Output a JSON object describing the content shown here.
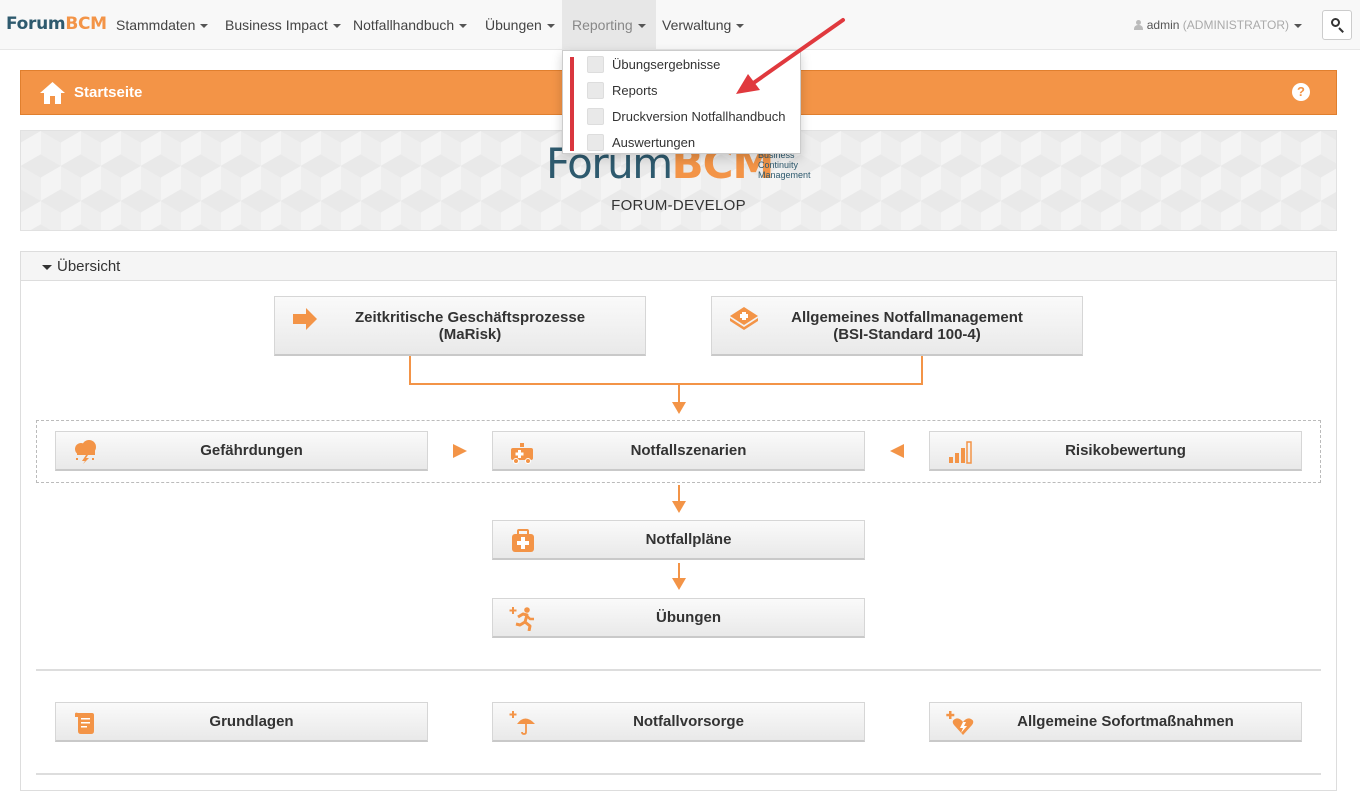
{
  "navbar": {
    "brand_forum": "Forum",
    "brand_bcm": "BCM",
    "items": [
      {
        "label": "Stammdaten"
      },
      {
        "label": "Business Impact"
      },
      {
        "label": "Notfallhandbuch"
      },
      {
        "label": "Übungen"
      },
      {
        "label": "Reporting"
      },
      {
        "label": "Verwaltung"
      }
    ],
    "user_name": "admin",
    "user_role": "(ADMINISTRATOR)"
  },
  "reporting_menu": {
    "items": [
      {
        "label": "Übungsergebnisse",
        "icon": "results-icon"
      },
      {
        "label": "Reports",
        "icon": "reports-icon"
      },
      {
        "label": "Druckversion Notfallhandbuch",
        "icon": "print-icon"
      },
      {
        "label": "Auswertungen",
        "icon": "evaluation-icon"
      }
    ]
  },
  "page": {
    "title": "Startseite",
    "help": "?",
    "logo_forum": "Forum",
    "logo_bcm": "BCM",
    "logo_sub": [
      "Business",
      "Continuity",
      "Management"
    ],
    "instance": "FORUM-DEVELOP"
  },
  "overview": {
    "label": "Übersicht",
    "tiles": {
      "processes_line1": "Zeitkritische Geschäftsprozesse",
      "processes_line2": "(MaRisk)",
      "general_line1": "Allgemeines Notfallmanagement",
      "general_line2": "(BSI-Standard 100-4)",
      "threats": "Gefährdungen",
      "scenarios": "Notfallszenarien",
      "risk": "Risikobewertung",
      "plans": "Notfallpläne",
      "exercises": "Übungen",
      "basics": "Grundlagen",
      "precaution": "Notfallvorsorge",
      "immediate": "Allgemeine Sofortmaßnahmen"
    }
  },
  "colors": {
    "accent": "#f39447",
    "brand_dark": "#2e5a6e",
    "annotation": "#e0393e"
  }
}
